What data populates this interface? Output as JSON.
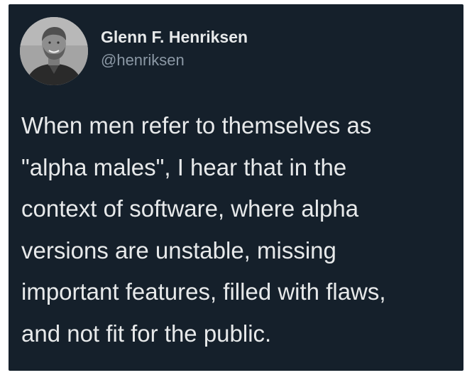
{
  "author": {
    "display_name": "Glenn F. Henriksen",
    "handle": "@henriksen"
  },
  "tweet": {
    "lines": [
      "When men refer to themselves as",
      "\"alpha males\", I hear that in the",
      "context of software, where alpha",
      "versions are unstable, missing",
      "important features, filled with flaws,",
      "and not fit for the public."
    ]
  },
  "colors": {
    "background": "#15202b",
    "text_primary": "#e7e9ea",
    "text_secondary": "#8b98a5"
  }
}
